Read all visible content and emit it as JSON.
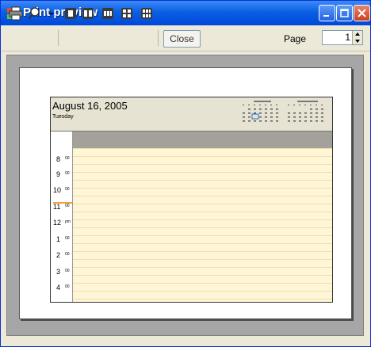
{
  "window": {
    "title": "Print preview",
    "accent": "#0a5fe4"
  },
  "toolbar": {
    "icons": [
      "printer-icon",
      "zoom-icon",
      "dropdown-arrow-icon",
      "one-page-icon",
      "two-page-icon",
      "three-page-icon",
      "four-page-icon",
      "six-page-icon"
    ],
    "close_label": "Close",
    "page_label": "Page",
    "page_value": "1"
  },
  "sheet": {
    "date": "August 16, 2005",
    "day": "Tuesday",
    "time_slots": [
      {
        "hour": "8",
        "min": "00"
      },
      {
        "hour": "9",
        "min": "00"
      },
      {
        "hour": "10",
        "min": "00"
      },
      {
        "hour": "11",
        "min": "00"
      },
      {
        "hour": "12",
        "min": "pm"
      },
      {
        "hour": "1",
        "min": "00"
      },
      {
        "hour": "2",
        "min": "00"
      },
      {
        "hour": "3",
        "min": "00"
      },
      {
        "hour": "4",
        "min": "00"
      }
    ],
    "mini_calendars": [
      "August 2005",
      "September 2005"
    ]
  }
}
